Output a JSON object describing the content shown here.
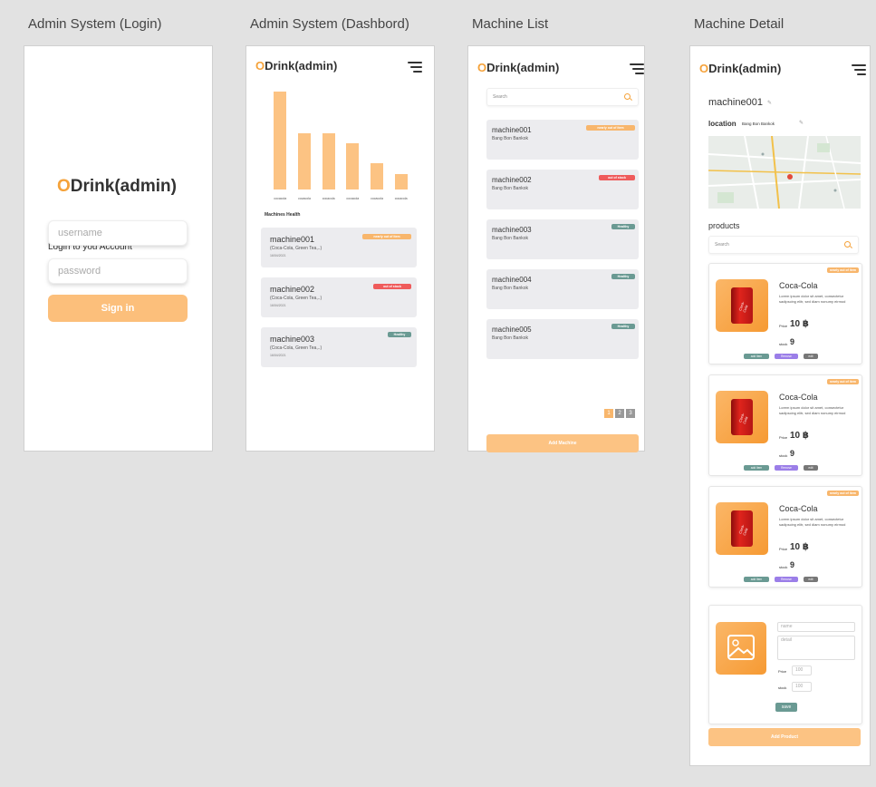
{
  "frames": {
    "login_title": "Admin System (Login)",
    "dashboard_title": "Admin System (Dashbord)",
    "list_title": "Machine List",
    "detail_title": "Machine Detail"
  },
  "brand": {
    "o": "O",
    "name": "Drink(admin)"
  },
  "login": {
    "heading": "Login to you Account",
    "username_placeholder": "username",
    "password_placeholder": "password",
    "signin_label": "Sign in"
  },
  "dashboard": {
    "machines_health_label": "Machines Health",
    "cards": [
      {
        "name": "machine001",
        "products": "(Coca-Cola, Green Tea,..)",
        "date": "16/04/2021",
        "status": "nearly out of item"
      },
      {
        "name": "machine002",
        "products": "(Coca-Cola, Green Tea,..)",
        "date": "16/04/2021",
        "status": "out of stock"
      },
      {
        "name": "machine003",
        "products": "(Coca-Cola, Green Tea,..)",
        "date": "16/04/2021",
        "status": "Healthy"
      }
    ]
  },
  "chart_data": {
    "type": "bar",
    "categories": [
      "cocacola",
      "cocacola",
      "cocacola",
      "cocacola",
      "cocacola",
      "cocacola"
    ],
    "values": [
      100,
      57,
      57,
      47,
      27,
      16
    ],
    "ylim": [
      0,
      100
    ],
    "title": "",
    "xlabel": "",
    "ylabel": "",
    "bar_color": "#fcc383"
  },
  "machine_list": {
    "search_placeholder": "Search",
    "machines": [
      {
        "name": "machine001",
        "location": "Bang Bon Bankok",
        "status": "nearly out of item"
      },
      {
        "name": "machine002",
        "location": "Bang Bon Bankok",
        "status": "out of stock"
      },
      {
        "name": "machine003",
        "location": "Bang Bon Bankok",
        "status": "Healthy"
      },
      {
        "name": "machine004",
        "location": "Bang Bon Bankok",
        "status": "Healthy"
      },
      {
        "name": "machine005",
        "location": "Bang Bon Bankok",
        "status": "Healthy"
      }
    ],
    "pages": [
      "1",
      "2",
      "3"
    ],
    "add_machine_label": "Add Machine"
  },
  "machine_detail": {
    "machine_name": "machine001",
    "location_label": "location",
    "location_value": "Bang Bon Bankok",
    "products_label": "products",
    "search_placeholder": "Search",
    "products": [
      {
        "badge": "nearly out of item",
        "name": "Coca-Cola",
        "description": "Lorem ipsum dolor sit amet, consectetur sadipscing elitr, sed diam nonumy eirmod",
        "price_label": "Price",
        "price": "10 ฿",
        "stock_label": "stock",
        "stock": "9",
        "tags": [
          "add Item",
          "Remove",
          "edit"
        ]
      },
      {
        "badge": "nearly out of item",
        "name": "Coca-Cola",
        "description": "Lorem ipsum dolor sit amet, consectetur sadipscing elitr, sed diam nonumy eirmod",
        "price_label": "Price",
        "price": "10 ฿",
        "stock_label": "stock",
        "stock": "9",
        "tags": [
          "add Item",
          "Remove",
          "edit"
        ]
      },
      {
        "badge": "nearly out of item",
        "name": "Coca-Cola",
        "description": "Lorem ipsum dolor sit amet, consectetur sadipscing elitr, sed diam nonumy eirmod",
        "price_label": "Price",
        "price": "10 ฿",
        "stock_label": "stock",
        "stock": "9",
        "tags": [
          "add Item",
          "Remove",
          "edit"
        ]
      }
    ],
    "new_product": {
      "name_placeholder": "name",
      "detail_placeholder": "detail",
      "price_label": "Price",
      "price_placeholder": "100",
      "stock_label": "stock",
      "stock_placeholder": "100",
      "save_label": "save"
    },
    "add_product_label": "Add Product"
  },
  "colors": {
    "accent": "#f5a23a",
    "orange_badge": "#f8b66c",
    "red_badge": "#ef5b5b",
    "green_badge": "#6a9a93",
    "button": "#fcc383"
  }
}
